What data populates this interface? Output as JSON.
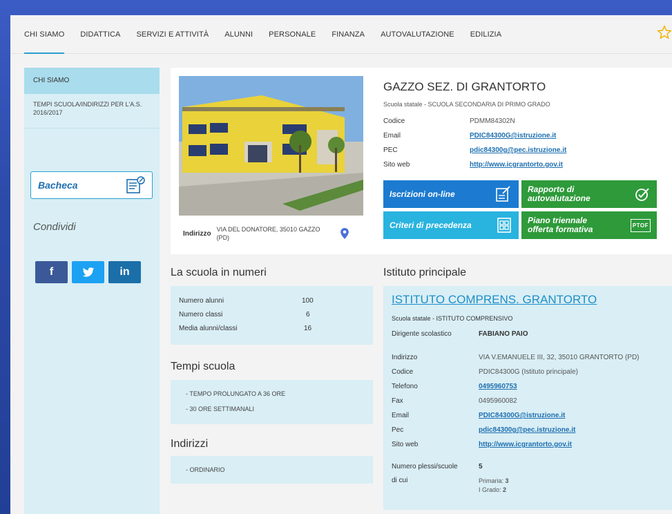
{
  "nav": {
    "items": [
      "CHI SIAMO",
      "DIDATTICA",
      "SERVIZI E ATTIVITÀ",
      "ALUNNI",
      "PERSONALE",
      "FINANZA",
      "AUTOVALUTAZIONE",
      "EDILIZIA"
    ],
    "active_index": 0
  },
  "sidebar": {
    "header": "CHI SIAMO",
    "link": "TEMPI SCUOLA/INDIRIZZI PER L'A.S. 2016/2017",
    "bacheca": "Bacheca",
    "condividi": "Condividi",
    "social": [
      "f",
      "t",
      "in"
    ]
  },
  "school": {
    "address_label": "Indirizzo",
    "address_value": "VIA DEL DONATORE, 35010 GAZZO (PD)",
    "title": "GAZZO SEZ. DI GRANTORTO",
    "subtitle": "Scuola statale - SCUOLA SECONDARIA DI PRIMO GRADO",
    "fields": [
      {
        "k": "Codice",
        "v": "PDMM84302N",
        "link": false
      },
      {
        "k": "Email",
        "v": "PDIC84300G@istruzione.it",
        "link": true
      },
      {
        "k": "PEC",
        "v": "pdic84300g@pec.istruzione.it",
        "link": true
      },
      {
        "k": "Sito web",
        "v": "http://www.icgrantorto.gov.it",
        "link": true
      }
    ],
    "tiles": {
      "iscrizioni": "Iscrizioni on-line",
      "rapporto_1": "Rapporto di",
      "rapporto_2": "autovalutazione",
      "criteri": "Criteri di precedenza",
      "piano_1": "Piano triennale",
      "piano_2": "offerta formativa",
      "ptof_icon_text": "PTOF"
    }
  },
  "numeri": {
    "title": "La scuola in numeri",
    "rows": [
      {
        "k": "Numero alunni",
        "v": "100"
      },
      {
        "k": "Numero classi",
        "v": "6"
      },
      {
        "k": "Media alunni/classi",
        "v": "16"
      }
    ]
  },
  "tempi": {
    "title": "Tempi scuola",
    "items": [
      "-   TEMPO PROLUNGATO A 36 ORE",
      "-   30 ORE SETTIMANALI"
    ]
  },
  "indirizzi": {
    "title": "Indirizzi",
    "items": [
      "-   ORDINARIO"
    ]
  },
  "principale": {
    "section_title": "Istituto principale",
    "name": "ISTITUTO COMPRENS. GRANTORTO",
    "subtitle": "Scuola statale - ISTITUTO COMPRENSIVO",
    "dirigente_label": "Dirigente scolastico",
    "dirigente_value": "FABIANO PAIO",
    "fields": [
      {
        "k": "Indirizzo",
        "v": "VIA V.EMANUELE III, 32, 35010 GRANTORTO (PD)",
        "link": false
      },
      {
        "k": "Codice",
        "v": "PDIC84300G (Istituto principale)",
        "link": false
      },
      {
        "k": "Telefono",
        "v": "0495960753",
        "link": true
      },
      {
        "k": "Fax",
        "v": "0495960082",
        "link": false
      },
      {
        "k": "Email",
        "v": "PDIC84300G@istruzione.it",
        "link": true
      },
      {
        "k": "Pec",
        "v": "pdic84300g@pec.istruzione.it",
        "link": true
      },
      {
        "k": "Sito web",
        "v": "http://www.icgrantorto.gov.it",
        "link": true
      }
    ],
    "plessi_label": "Numero plessi/scuole",
    "plessi_value": "5",
    "dicui_label": "di cui",
    "primaria_label": "Primaria:",
    "primaria_value": "3",
    "grado_label": "I Grado:",
    "grado_value": "2"
  }
}
